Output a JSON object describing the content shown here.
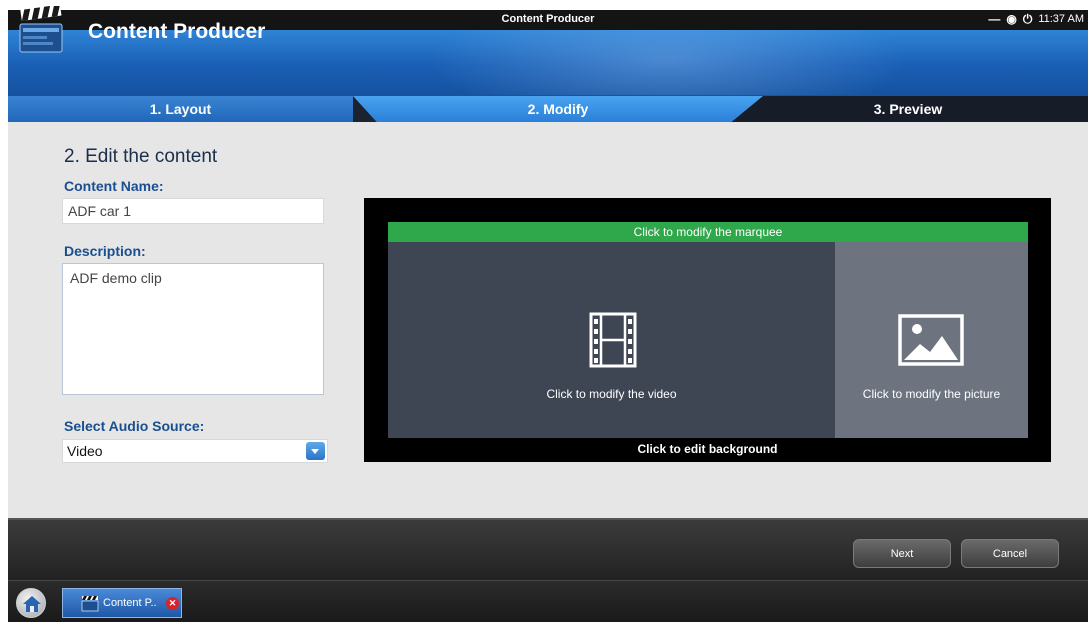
{
  "system_bar": {
    "title": "Content Producer",
    "time": "11:37 AM",
    "minimize_icon": "minimize-icon",
    "settings_icon": "gear-icon",
    "power_icon": "power-icon"
  },
  "header": {
    "app_name": "Content Producer",
    "logo": "clapperboard-icon"
  },
  "steps": [
    {
      "label": "1. Layout",
      "state": "done"
    },
    {
      "label": "2. Modify",
      "state": "active"
    },
    {
      "label": "3. Preview",
      "state": "pending"
    }
  ],
  "form": {
    "heading": "2. Edit the content",
    "content_name_label": "Content Name:",
    "content_name_value": "ADF car 1",
    "description_label": "Description:",
    "description_value": "ADF demo clip",
    "audio_label": "Select Audio Source:",
    "audio_value": "Video"
  },
  "preview": {
    "marquee": "Click to modify the marquee",
    "video": "Click to modify the video",
    "picture": "Click to modify the picture",
    "background": "Click to edit background",
    "colors": {
      "marquee": "#2ea84a",
      "video": "#3e4553",
      "picture": "#6d7480",
      "frame": "#000000"
    }
  },
  "footer": {
    "next": "Next",
    "cancel": "Cancel"
  },
  "taskbar": {
    "home_icon": "home-icon",
    "task_label": "Content P..",
    "task_close_icon": "close-icon"
  },
  "colors": {
    "accent": "#2a7ed8",
    "header": "#1a5fb5"
  }
}
